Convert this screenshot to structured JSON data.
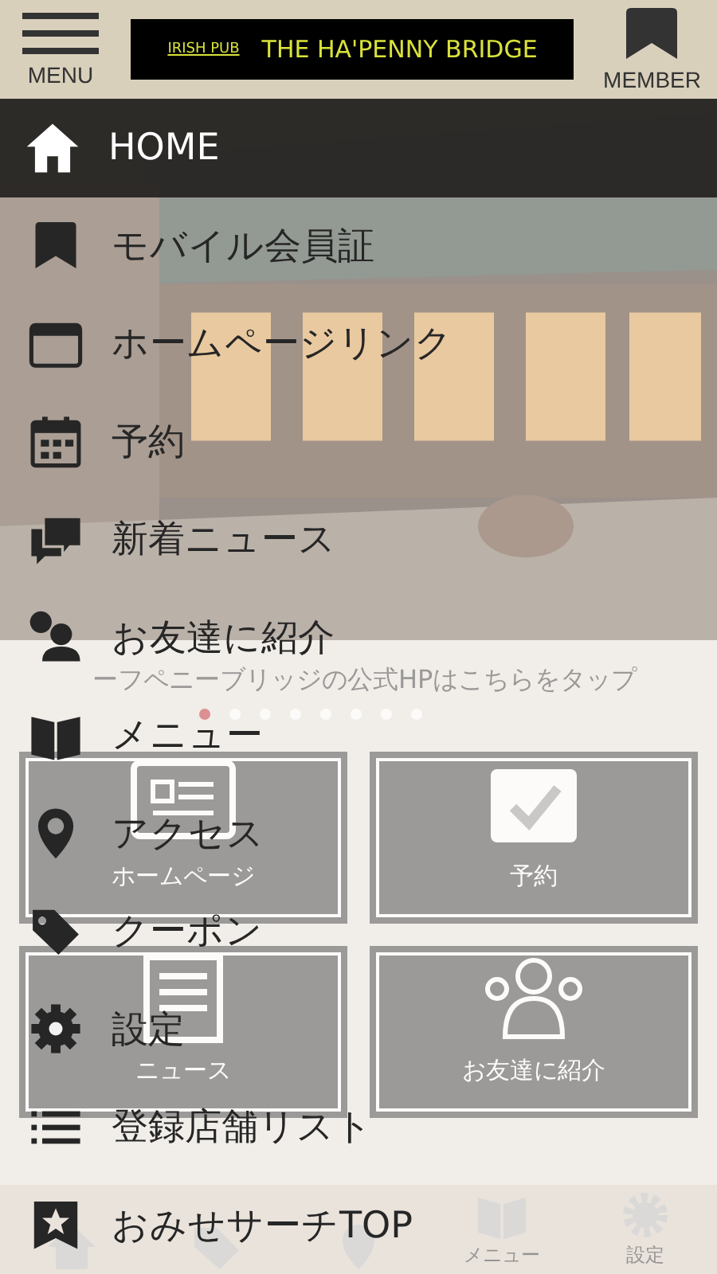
{
  "header": {
    "menu_button": "MENU",
    "logo": {
      "tag": "IRISH PUB",
      "name": "THE HA'PENNY BRIDGE"
    },
    "member_button": "MEMBER"
  },
  "background": {
    "link_text": "ーフペニーブリッジの公式HPはこちらをタップ",
    "carousel": [
      {
        "selected": true
      },
      {
        "selected": false
      },
      {
        "selected": false
      },
      {
        "selected": false
      },
      {
        "selected": false
      },
      {
        "selected": false
      },
      {
        "selected": false
      },
      {
        "selected": false
      }
    ],
    "tiles": [
      {
        "label": "ホームページ"
      },
      {
        "label": "予約"
      },
      {
        "label": "ニュース"
      },
      {
        "label": "お友達に紹介"
      }
    ],
    "tab_bar": [
      {
        "label": "メニュー"
      },
      {
        "label": "設定"
      }
    ]
  },
  "menu": [
    {
      "label": "HOME",
      "selected": true
    },
    {
      "label": "モバイル会員証",
      "selected": false
    },
    {
      "label": "ホームページリンク",
      "selected": false
    },
    {
      "label": "予約",
      "selected": false
    },
    {
      "label": "新着ニュース",
      "selected": false
    },
    {
      "label": "お友達に紹介",
      "selected": false
    },
    {
      "label": "メニュー",
      "selected": false
    },
    {
      "label": "アクセス",
      "selected": false
    },
    {
      "label": "クーポン",
      "selected": false
    },
    {
      "label": "設定",
      "selected": false
    },
    {
      "label": "登録店舗リスト",
      "selected": false
    },
    {
      "label": "おみせサーチTOP",
      "selected": false
    }
  ]
}
